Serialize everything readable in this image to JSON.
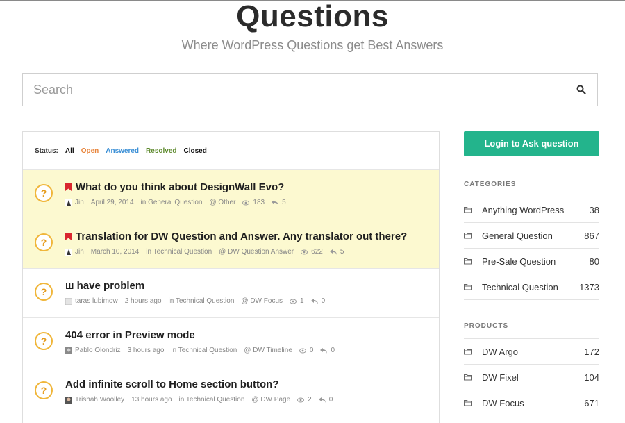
{
  "page": {
    "title": "Questions",
    "subtitle": "Where WordPress Questions get Best Answers"
  },
  "search": {
    "placeholder": "Search",
    "value": ""
  },
  "filters": {
    "label": "Status:",
    "all": "All",
    "open": "Open",
    "answered": "Answered",
    "resolved": "Resolved",
    "closed": "Closed"
  },
  "questions": [
    {
      "title": "What do you think about DesignWall Evo?",
      "author": "Jin",
      "date": "April 29, 2014",
      "category": "in General Question",
      "tag": "@ Other",
      "views": "183",
      "answers": "5"
    },
    {
      "title": "Translation for DW Question and Answer. Any translator out there?",
      "author": "Jin",
      "date": "March 10, 2014",
      "category": "in Technical Question",
      "tag": "@ DW Question Answer",
      "views": "622",
      "answers": "5"
    },
    {
      "title": "ш have problem",
      "author": "taras lubimow",
      "date": "2 hours ago",
      "category": "in Technical Question",
      "tag": "@ DW Focus",
      "views": "1",
      "answers": "0"
    },
    {
      "title": "404 error in Preview mode",
      "author": "Pablo Olondriz",
      "date": "3 hours ago",
      "category": "in Technical Question",
      "tag": "@ DW Timeline",
      "views": "0",
      "answers": "0"
    },
    {
      "title": "Add infinite scroll to Home section button?",
      "author": "Trishah Woolley",
      "date": "13 hours ago",
      "category": "in Technical Question",
      "tag": "@ DW Page",
      "views": "2",
      "answers": "0"
    }
  ],
  "question_badge": "?",
  "sidebar": {
    "login_label": "Login to Ask question",
    "categories_heading": "CATEGORIES",
    "categories": [
      {
        "name": "Anything WordPress",
        "count": "38"
      },
      {
        "name": "General Question",
        "count": "867"
      },
      {
        "name": "Pre-Sale Question",
        "count": "80"
      },
      {
        "name": "Technical Question",
        "count": "1373"
      }
    ],
    "products_heading": "PRODUCTS",
    "products": [
      {
        "name": "DW Argo",
        "count": "172"
      },
      {
        "name": "DW Fixel",
        "count": "104"
      },
      {
        "name": "DW Focus",
        "count": "671"
      }
    ]
  },
  "colors": {
    "accent": "#23b48c",
    "open": "#e8843a",
    "answered": "#3a8fd6",
    "resolved": "#5e8a2e",
    "sticky_bg": "#fcf9d0",
    "badge": "#f0b63a",
    "flag": "#d9262f"
  }
}
